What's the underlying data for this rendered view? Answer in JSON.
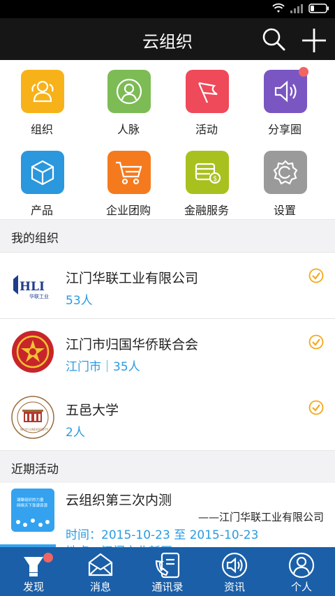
{
  "status": {
    "icons": [
      "wifi-icon",
      "signal-icon",
      "battery-icon"
    ]
  },
  "header": {
    "title": "云组织",
    "actions": [
      "search-icon",
      "add-icon"
    ]
  },
  "grid": [
    {
      "label": "组织",
      "icon": "people-icon",
      "color": "#f7b21a"
    },
    {
      "label": "人脉",
      "icon": "contact-icon",
      "color": "#7dbb55"
    },
    {
      "label": "活动",
      "icon": "flag-icon",
      "color": "#ee4a5a"
    },
    {
      "label": "分享圈",
      "icon": "speaker-icon",
      "color": "#7a56c2",
      "badge": true
    },
    {
      "label": "产品",
      "icon": "box-icon",
      "color": "#2b97dd"
    },
    {
      "label": "企业团购",
      "icon": "cart-icon",
      "color": "#f57a1e"
    },
    {
      "label": "金融服务",
      "icon": "finance-icon",
      "color": "#a9c11e"
    },
    {
      "label": "设置",
      "icon": "settings-icon",
      "color": "#9a9a9a"
    }
  ],
  "my_orgs": {
    "title": "我的组织",
    "items": [
      {
        "name": "江门华联工业有限公司",
        "meta": "53人",
        "logo": "hli-logo",
        "logo_text": "HLI",
        "logo_sub": "华联工业"
      },
      {
        "name": "江门市归国华侨联合会",
        "meta": "江门市｜35人",
        "logo": "emblem-logo"
      },
      {
        "name": "五邑大学",
        "meta": "2人",
        "logo": "university-seal",
        "logo_text": "WUYI UNIVERSITY"
      }
    ]
  },
  "recent": {
    "title": "近期活动",
    "items": [
      {
        "title": "云组织第三次内测",
        "org": "——江门华联工业有限公司",
        "time": "时间：2015-10-23 至 2015-10-23",
        "location": "地点：江门市北新区",
        "thumb_line1": "凝聚组织的力量",
        "thumb_line2": "网络天下靠谱资源"
      }
    ]
  },
  "tabs": [
    {
      "label": "发现",
      "icon": "discover-icon",
      "badge": true,
      "active": true
    },
    {
      "label": "消息",
      "icon": "message-icon"
    },
    {
      "label": "通讯录",
      "icon": "phonebook-icon"
    },
    {
      "label": "资讯",
      "icon": "news-icon"
    },
    {
      "label": "个人",
      "icon": "person-icon"
    }
  ],
  "colors": {
    "accent": "#2a9be0",
    "tabbar": "#1a5fa8",
    "appbar": "#161616",
    "section_bg": "#f2f2f4",
    "check": "#f4a81a",
    "badge": "#f06464"
  }
}
